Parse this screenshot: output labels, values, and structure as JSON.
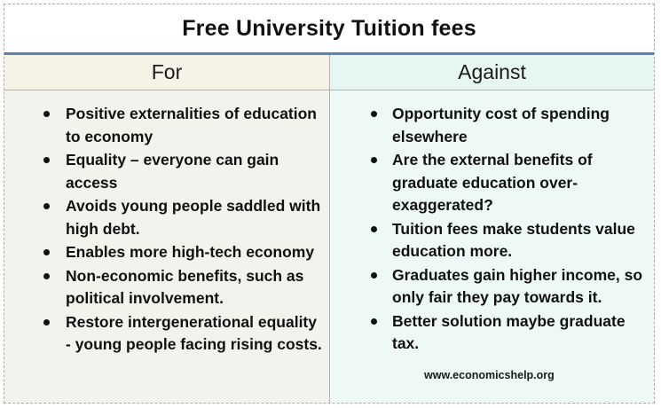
{
  "title": "Free University Tuition fees",
  "columns": {
    "for": {
      "header": "For",
      "items": [
        "Positive externalities of education to economy",
        "Equality – everyone can gain access",
        "Avoids young people saddled with high debt.",
        "Enables more high-tech economy",
        "Non-economic benefits, such as political involvement.",
        "Restore intergenerational equality - young people facing rising costs."
      ]
    },
    "against": {
      "header": "Against",
      "items": [
        "Opportunity cost of spending elsewhere",
        "Are the external benefits of graduate education over-exaggerated?",
        "Tuition fees make students value education more.",
        "Graduates gain higher income, so only fair they pay towards it.",
        "Better solution maybe graduate tax."
      ]
    }
  },
  "source": "www.economicshelp.org",
  "colors": {
    "title_underline": "#5b82b3",
    "for_background": "#f3f2ec",
    "against_background": "#eef8f6",
    "divider": "#9db7cc"
  }
}
